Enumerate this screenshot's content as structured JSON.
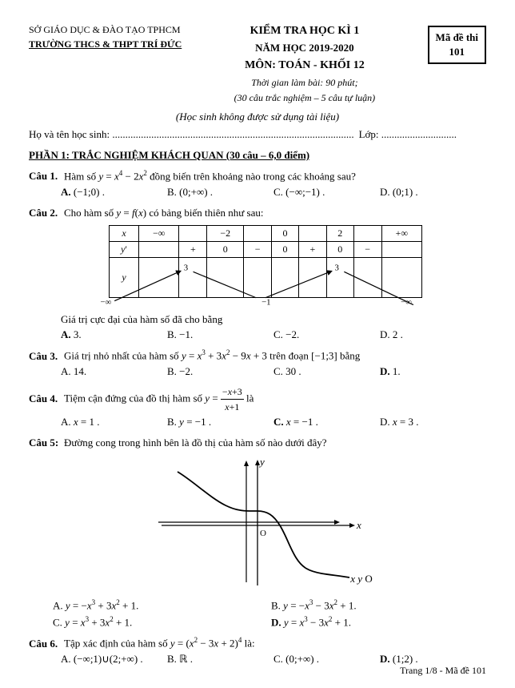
{
  "header": {
    "dept": "SỞ GIÁO DỤC & ĐÀO TẠO TPHCM",
    "school": "TRƯỜNG THCS & THPT TRÍ ĐỨC",
    "exam_title": "KIỂM TRA HỌC KÌ 1",
    "year": "NĂM HỌC 2019-2020",
    "subject": "MÔN: TOÁN - KHỐI 12",
    "time_note": "Thời gian làm bài: 90 phút;",
    "time_note2": "(30 câu trắc nghiệm – 5 câu tự luận)",
    "ma_de_label": "Mã đề thi",
    "ma_de_num": "101"
  },
  "instruction": "(Học sinh không được sử dụng tài liệu)",
  "student_label": "Họ và tên học sinh: .............................................................................................",
  "lop_label": "Lớp: .............................",
  "section1_title": "PHẦN 1: TRẮC NGHIỆM KHÁCH QUAN (30 câu – 6,0 điểm)",
  "questions": [
    {
      "num": "Câu 1.",
      "text": "Hàm số y = x⁴ − 2x² đồng biến trên khoảng nào trong các khoảng sau?",
      "answers": [
        {
          "label": "A.",
          "val": "(−1;0) .",
          "bold": true
        },
        {
          "label": "B.",
          "val": "(0;+∞) .",
          "bold": false
        },
        {
          "label": "C.",
          "val": "(−∞;−1) .",
          "bold": false
        },
        {
          "label": "D.",
          "val": "(0;1) .",
          "bold": false
        }
      ]
    },
    {
      "num": "Câu 2.",
      "text": "Cho hàm số y = f(x) có bảng biến thiên như sau:",
      "has_table": true,
      "table_note": "Giá trị cực đại của hàm số đã cho bằng",
      "answers": [
        {
          "label": "A.",
          "val": "3.",
          "bold": true
        },
        {
          "label": "B.",
          "val": "−1.",
          "bold": false
        },
        {
          "label": "C.",
          "val": "−2.",
          "bold": false
        },
        {
          "label": "D.",
          "val": "2 .",
          "bold": false
        }
      ]
    },
    {
      "num": "Câu 3.",
      "text": "Giá trị nhỏ nhất của hàm số y = x³ + 3x² − 9x + 3 trên đoạn [−1;3] bằng",
      "answers": [
        {
          "label": "A.",
          "val": "14.",
          "bold": false
        },
        {
          "label": "B.",
          "val": "−2.",
          "bold": false
        },
        {
          "label": "C.",
          "val": "30 .",
          "bold": false
        },
        {
          "label": "D.",
          "val": "1.",
          "bold": true
        }
      ]
    },
    {
      "num": "Câu 4.",
      "text": "Tiệm cận đứng của đồ thị hàm số y = (−x+3)/(x+1) là",
      "answers": [
        {
          "label": "A.",
          "val": "x = 1 .",
          "bold": false
        },
        {
          "label": "B.",
          "val": "y = −1 .",
          "bold": false
        },
        {
          "label": "C.",
          "val": "x = −1 .",
          "bold": true
        },
        {
          "label": "D.",
          "val": "x = 3 .",
          "bold": false
        }
      ]
    },
    {
      "num": "Câu 5:",
      "text": "Đường cong trong hình bên là đồ thị của hàm số nào dưới đây?",
      "has_graph": true,
      "answers": [
        {
          "label": "A.",
          "val": "y = −x³ + 3x² + 1.",
          "bold": false
        },
        {
          "label": "B.",
          "val": "y = −x³ − 3x² + 1.",
          "bold": false
        },
        {
          "label": "C.",
          "val": "y = x³ + 3x² + 1.",
          "bold": false
        },
        {
          "label": "D.",
          "val": "y = x³ − 3x² + 1.",
          "bold": true
        }
      ]
    },
    {
      "num": "Câu 6.",
      "text": "Tập xác định của hàm số y = (x² − 3x + 2)⁴ là:",
      "answers": [
        {
          "label": "A.",
          "val": "(−∞;1)∪(2;+∞) .",
          "bold": false
        },
        {
          "label": "B.",
          "val": "ℝ .",
          "bold": false
        },
        {
          "label": "C.",
          "val": "(0;+∞) .",
          "bold": false
        },
        {
          "label": "D.",
          "val": "(1;2) .",
          "bold": true
        }
      ]
    }
  ],
  "footer": "Trang 1/8 - Mã đề 101"
}
